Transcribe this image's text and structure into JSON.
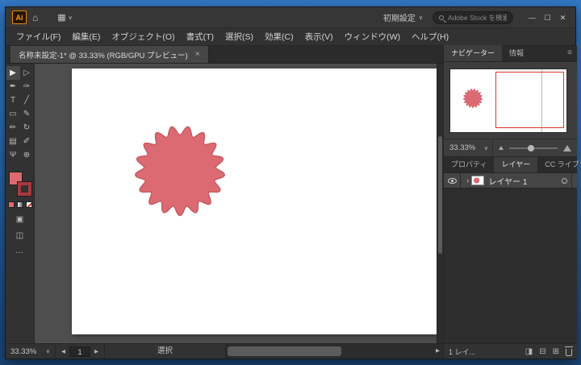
{
  "window_controls": {
    "minimize": "—",
    "maximize": "☐",
    "close": "✕"
  },
  "titlebar": {
    "app_icon": "Ai",
    "home_icon": "⌂",
    "arrange_icon": "▦",
    "caret": "∨",
    "workspace_label": "初期設定",
    "search_placeholder": "Adobe Stock を検索"
  },
  "menubar": {
    "items": [
      "ファイル(F)",
      "編集(E)",
      "オブジェクト(O)",
      "書式(T)",
      "選択(S)",
      "効果(C)",
      "表示(V)",
      "ウィンドウ(W)",
      "ヘルプ(H)"
    ]
  },
  "document_tab": {
    "title": "名称未設定-1* @ 33.33% (RGB/GPU プレビュー)",
    "close_icon": "×"
  },
  "toolbar": {
    "tools": [
      {
        "name": "selection",
        "glyph": "▶"
      },
      {
        "name": "direct-selection",
        "glyph": "▷"
      },
      {
        "name": "pen",
        "glyph": "✒"
      },
      {
        "name": "curvature",
        "glyph": "✑"
      },
      {
        "name": "type",
        "glyph": "T"
      },
      {
        "name": "line-segment",
        "glyph": "╱"
      },
      {
        "name": "rectangle",
        "glyph": "▭"
      },
      {
        "name": "paintbrush",
        "glyph": "✎"
      },
      {
        "name": "pencil",
        "glyph": "✏"
      },
      {
        "name": "rotate",
        "glyph": "↻"
      },
      {
        "name": "gradient",
        "glyph": "▤"
      },
      {
        "name": "eyedropper",
        "glyph": "✐"
      },
      {
        "name": "hand",
        "glyph": "Ψ"
      },
      {
        "name": "zoom",
        "glyph": "⊕"
      }
    ],
    "fill_color": "#dc6a72",
    "stroke_color": "#a8383e",
    "draw_mode_icon": "▣",
    "screen_mode_icon": "◫",
    "more_icon": "…"
  },
  "canvas": {
    "shape": {
      "fill": "#dc6a72",
      "stroke": "#c75b62",
      "bumps": 17,
      "r": 50,
      "amp": 5.5
    }
  },
  "statusbar": {
    "zoom": "33.33%",
    "caret": "∨",
    "prev_icon": "◀",
    "artboard_number": "1",
    "next_icon": "▶",
    "tool_label": "選択",
    "scroll_arrow": "▶"
  },
  "navigator": {
    "tab_navigator": "ナビゲーター",
    "tab_info": "情報",
    "menu_icon": "≡",
    "zoom": "33.33%",
    "caret": "∨",
    "proxy_color": "#e0352b"
  },
  "panels": {
    "tab_properties": "プロパティ",
    "tab_layers": "レイヤー",
    "tab_libraries": "CC ライブラリ",
    "menu_icon": "≡"
  },
  "layers": {
    "row": {
      "expand_icon": "›",
      "name": "レイヤー 1"
    },
    "footer_text": "1 レイ...",
    "mask_icon": "◨",
    "new_sublayer_icon": "⊟",
    "new_layer_icon": "⊞"
  }
}
